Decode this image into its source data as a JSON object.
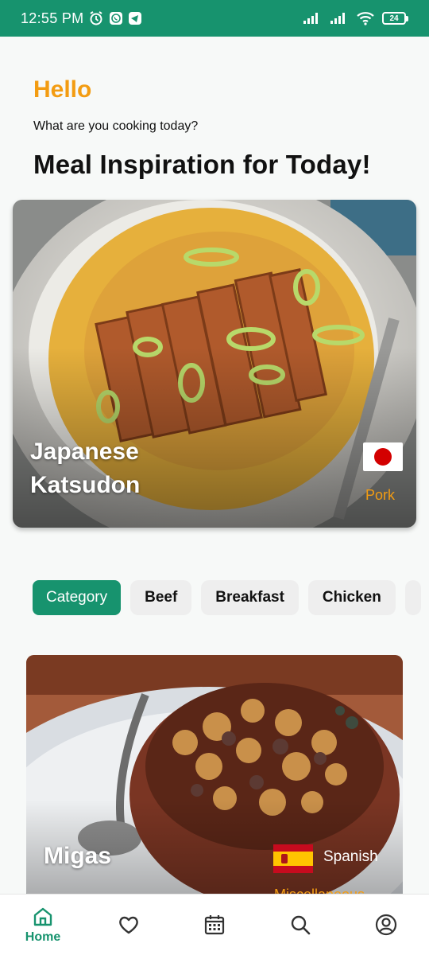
{
  "status_bar": {
    "time": "12:55 PM",
    "left_icons": [
      "alarm-icon",
      "whatsapp-icon",
      "telegram-icon"
    ],
    "right_icons": [
      "signal-icon",
      "signal-icon",
      "wifi-icon",
      "battery-icon"
    ],
    "battery": "24"
  },
  "greeting": {
    "hello": "Hello",
    "subtitle": "What are you cooking today?"
  },
  "section_title": "Meal Inspiration for Today!",
  "featured": {
    "name": "Japanese Katsudon",
    "category": "Pork",
    "flag": "japan-flag"
  },
  "chips": [
    {
      "label": "Category",
      "active": true
    },
    {
      "label": "Beef",
      "active": false
    },
    {
      "label": "Breakfast",
      "active": false
    },
    {
      "label": "Chicken",
      "active": false
    },
    {
      "label": "",
      "active": false
    }
  ],
  "meal": {
    "name": "Migas",
    "area": "Spanish",
    "category": "Miscellaneous",
    "flag": "spain-flag"
  },
  "bottom_nav": [
    {
      "label": "Home",
      "icon": "home-icon",
      "active": true
    },
    {
      "label": "",
      "icon": "heart-icon",
      "active": false
    },
    {
      "label": "",
      "icon": "calendar-icon",
      "active": false
    },
    {
      "label": "",
      "icon": "search-icon",
      "active": false
    },
    {
      "label": "",
      "icon": "profile-icon",
      "active": false
    }
  ],
  "colors": {
    "primary": "#17936e",
    "accent": "#f39c12"
  }
}
